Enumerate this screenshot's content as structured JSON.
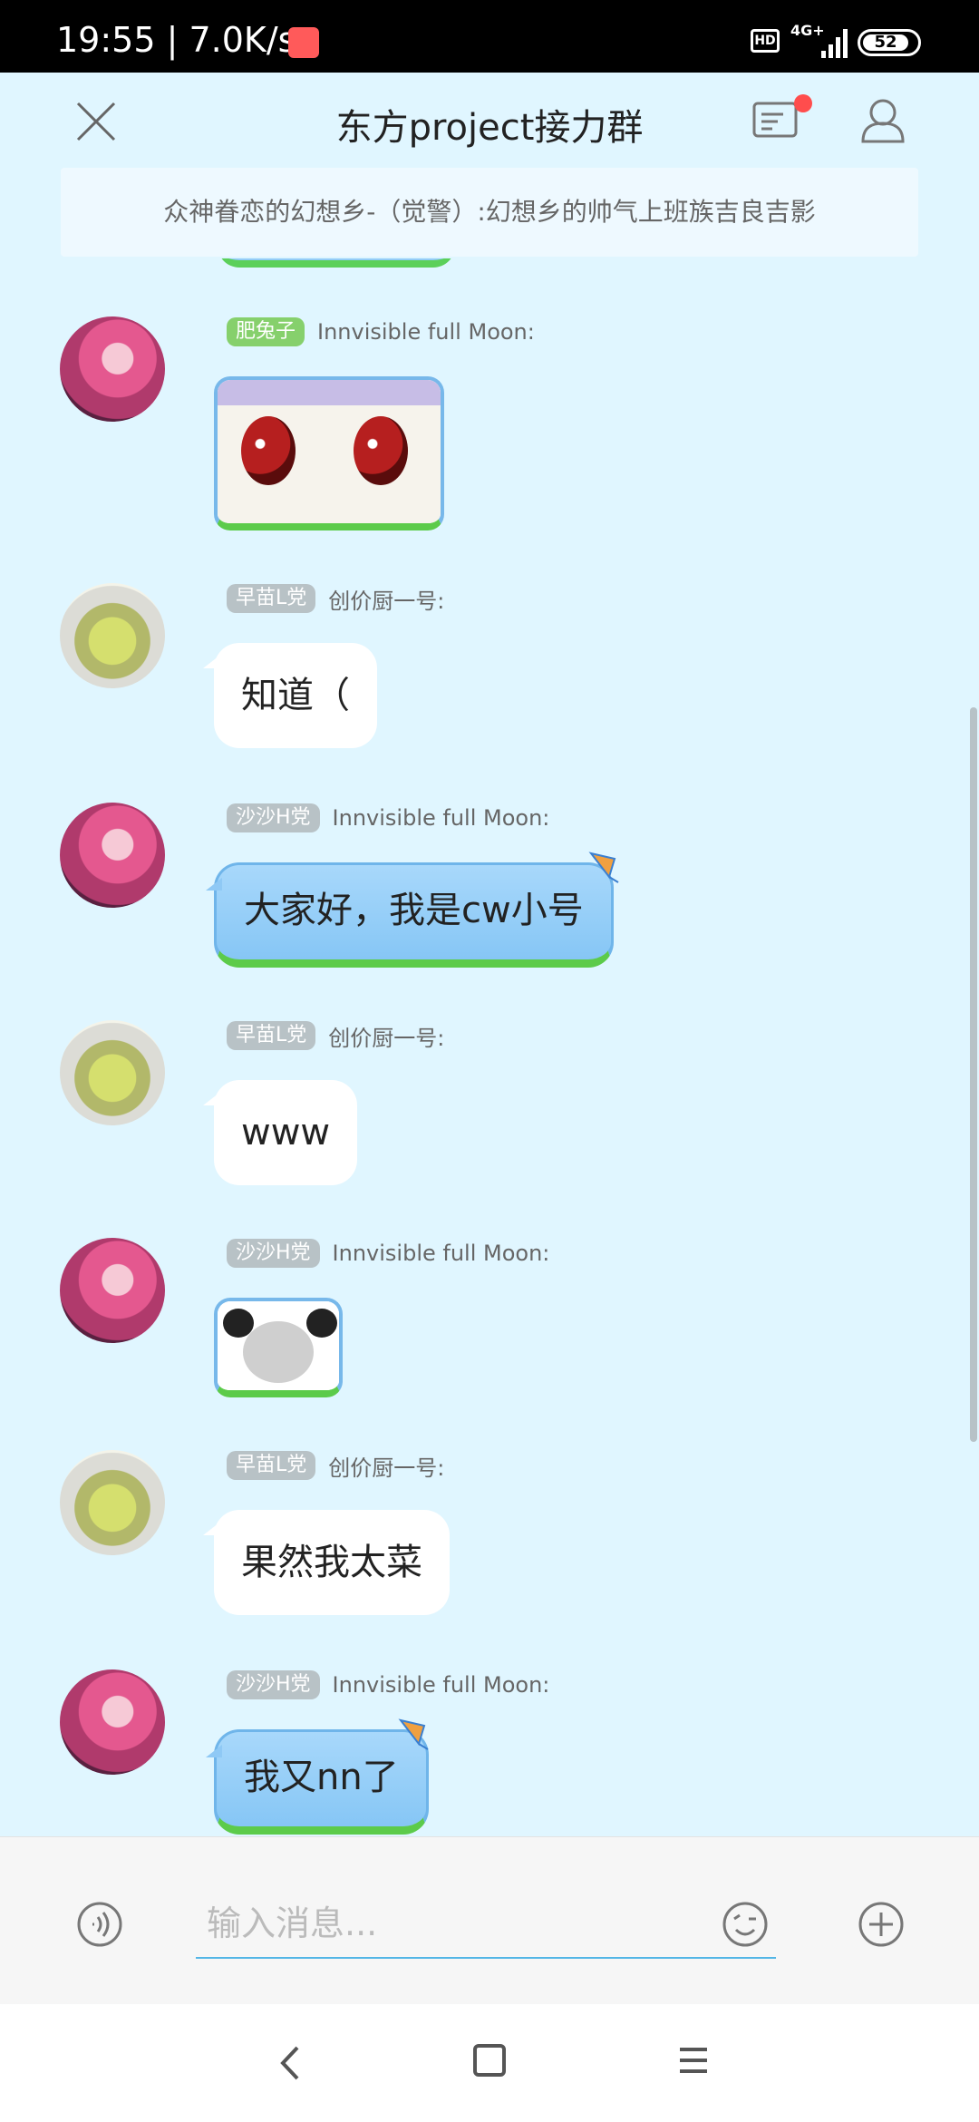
{
  "status_bar": {
    "time": "19:55",
    "speed": "7.0K/s",
    "hd": "HD",
    "network": "4G+",
    "battery": "52"
  },
  "header": {
    "title": "东方project接力群"
  },
  "announcement": "众神眷恋的幻想乡-（觉警）:幻想乡的帅气上班族吉良吉影",
  "messages": [
    {
      "badge": "肥兔子",
      "sender": "Innvisible full Moon:",
      "type": "sticker"
    },
    {
      "badge": "早苗L党",
      "sender": "创价厨一号:",
      "text": "知道（"
    },
    {
      "badge": "沙沙H党",
      "sender": "Innvisible full Moon:",
      "text": "大家好，我是cw小号"
    },
    {
      "badge": "早苗L党",
      "sender": "创价厨一号:",
      "text": "www"
    },
    {
      "badge": "沙沙H党",
      "sender": "Innvisible full Moon:",
      "type": "sticker"
    },
    {
      "badge": "早苗L党",
      "sender": "创价厨一号:",
      "text": "果然我太菜"
    },
    {
      "badge": "沙沙H党",
      "sender": "Innvisible full Moon:",
      "text": "我又nn了"
    }
  ],
  "input": {
    "placeholder": "输入消息..."
  },
  "colors": {
    "background": "#e0f6ff",
    "accent": "#53b6e6",
    "bubble_blue": "#86c6f5",
    "badge_green": "#86d06c",
    "badge_gray": "#b8c2c6"
  }
}
